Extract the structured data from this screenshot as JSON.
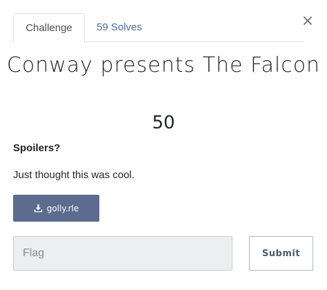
{
  "modal": {
    "close_label": "×",
    "tabs": [
      {
        "label": "Challenge",
        "active": true
      },
      {
        "label": "59 Solves",
        "active": false
      }
    ],
    "challenge": {
      "title": "Conway presents The Falcon",
      "value": "50",
      "description_heading": "Spoilers?",
      "description_text": "Just thought this was cool."
    },
    "file": {
      "label": "golly.rle",
      "icon": "download-icon"
    },
    "flag_input": {
      "placeholder": "Flag",
      "value": ""
    },
    "submit_label": "Submit",
    "colors": {
      "file_button": "#5c6c8f",
      "tab_link": "#4a6fa5"
    }
  }
}
